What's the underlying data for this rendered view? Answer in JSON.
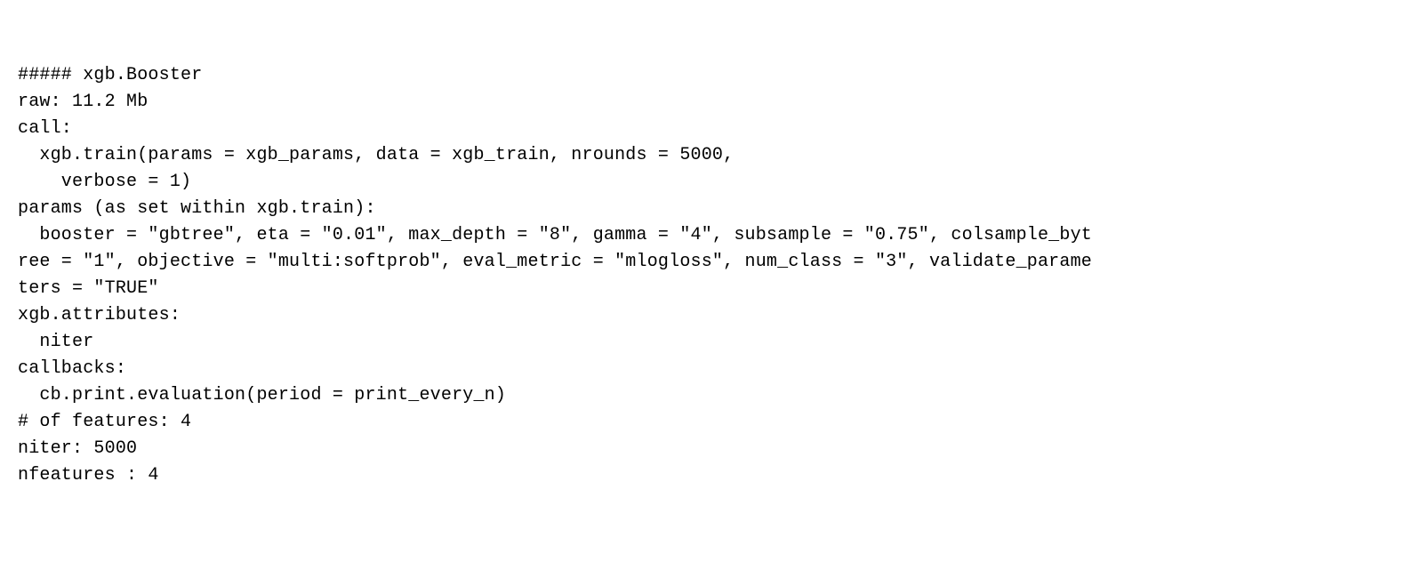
{
  "lines": {
    "l1": "##### xgb.Booster",
    "l2": "raw: 11.2 Mb",
    "l3": "call:",
    "l4": "  xgb.train(params = xgb_params, data = xgb_train, nrounds = 5000, ",
    "l5": "    verbose = 1)",
    "l6": "params (as set within xgb.train):",
    "l7": "  booster = \"gbtree\", eta = \"0.01\", max_depth = \"8\", gamma = \"4\", subsample = \"0.75\", colsample_byt",
    "l8": "ree = \"1\", objective = \"multi:softprob\", eval_metric = \"mlogloss\", num_class = \"3\", validate_parame",
    "l9": "ters = \"TRUE\"",
    "l10": "xgb.attributes:",
    "l11": "  niter",
    "l12": "callbacks:",
    "l13": "  cb.print.evaluation(period = print_every_n)",
    "l14": "# of features: 4 ",
    "l15": "niter: 5000",
    "l16": "nfeatures : 4 "
  }
}
